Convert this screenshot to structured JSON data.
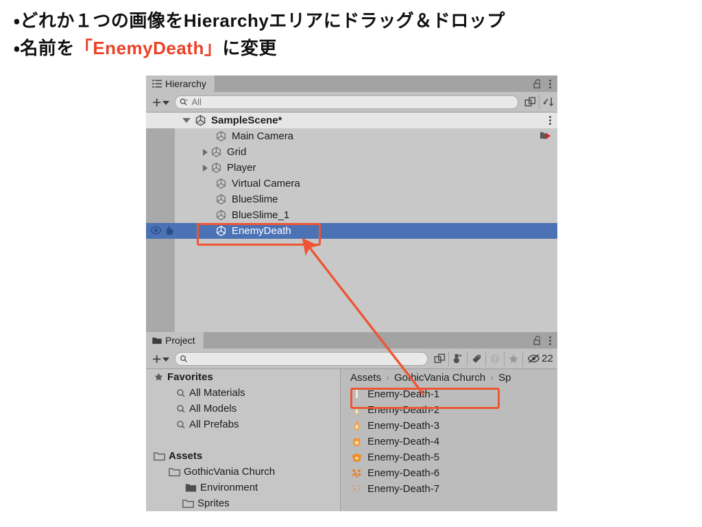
{
  "instructions": {
    "line1": "・どれか１つの画像をHierarchyエリアにドラッグ＆ドロップ",
    "line2_pre": "・名前を",
    "line2_highlight": "「EnemyDeath」",
    "line2_post": "に変更",
    "highlight_color": "#ec4126"
  },
  "hierarchy": {
    "tab_label": "Hierarchy",
    "tab_icon": "hierarchy-list-icon",
    "lock_icon": "lock-open-icon",
    "menu_icon": "kebab-menu-icon",
    "toolbar": {
      "add_label": "+",
      "add_dropdown_icon": "chevron-down-icon",
      "search_value": "",
      "search_placeholder": "All",
      "search_icon": "search-dropdown-icon",
      "expand_icon": "open-in-new-icon",
      "sort_icon": "sort-descending-icon"
    },
    "scene": {
      "name": "SampleScene*",
      "expanded": true,
      "icon": "unity-scene-icon",
      "menu_icon": "kebab-menu-icon"
    },
    "items": [
      {
        "name": "Main Camera",
        "expandable": false,
        "selected": false,
        "badge_icon": "cinemachine-brain-icon"
      },
      {
        "name": "Grid",
        "expandable": true,
        "selected": false
      },
      {
        "name": "Player",
        "expandable": true,
        "selected": false
      },
      {
        "name": "Virtual Camera",
        "expandable": false,
        "selected": false
      },
      {
        "name": "BlueSlime",
        "expandable": false,
        "selected": false
      },
      {
        "name": "BlueSlime_1",
        "expandable": false,
        "selected": false
      },
      {
        "name": "EnemyDeath",
        "expandable": false,
        "selected": true,
        "vis_icons": [
          "eye-icon",
          "hand-icon"
        ]
      }
    ],
    "selection_color": "#4a72b5"
  },
  "project": {
    "tab_label": "Project",
    "tab_icon": "folder-icon",
    "lock_icon": "lock-open-icon",
    "menu_icon": "kebab-menu-icon",
    "toolbar": {
      "add_label": "+",
      "add_dropdown_icon": "chevron-down-icon",
      "search_value": "",
      "search_placeholder": "",
      "search_icon": "search-icon",
      "expand_icon": "open-in-new-icon",
      "type_filter_icon": "asset-type-filter-icon",
      "label_filter_icon": "label-tag-icon",
      "warning_filter_icon": "warning-circle-icon",
      "favorite_filter_icon": "star-icon",
      "hidden_packages_icon": "eye-off-icon",
      "hidden_packages_count": "22"
    },
    "tree": [
      {
        "label": "Favorites",
        "indent": 0,
        "twisty": "down",
        "icon": "star-icon",
        "bold": true
      },
      {
        "label": "All Materials",
        "indent": 1,
        "twisty": "none",
        "icon": "search-icon",
        "bold": false
      },
      {
        "label": "All Models",
        "indent": 1,
        "twisty": "none",
        "icon": "search-icon",
        "bold": false
      },
      {
        "label": "All Prefabs",
        "indent": 1,
        "twisty": "none",
        "icon": "search-icon",
        "bold": false
      },
      {
        "label": "",
        "indent": 0,
        "twisty": "none",
        "icon": "none",
        "bold": false
      },
      {
        "label": "Assets",
        "indent": 0,
        "twisty": "down",
        "icon": "folder-open-icon",
        "bold": true
      },
      {
        "label": "GothicVania Church",
        "indent": 1,
        "twisty": "down",
        "icon": "folder-open-icon",
        "bold": false
      },
      {
        "label": "Environment",
        "indent": 2,
        "twisty": "none",
        "icon": "folder-icon",
        "bold": false
      },
      {
        "label": "Sprites",
        "indent": 2,
        "twisty": "down",
        "icon": "folder-open-icon",
        "bold": false
      }
    ],
    "breadcrumb": [
      "Assets",
      "GothicVania Church",
      "Sp"
    ],
    "breadcrumb_separator": "›",
    "assets": [
      {
        "name": "Enemy-Death-1",
        "expandable": true,
        "thumb": "sprite-death-1",
        "highlighted": true
      },
      {
        "name": "Enemy-Death-2",
        "expandable": true,
        "thumb": "sprite-death-2",
        "highlighted": false
      },
      {
        "name": "Enemy-Death-3",
        "expandable": true,
        "thumb": "sprite-death-3",
        "highlighted": false
      },
      {
        "name": "Enemy-Death-4",
        "expandable": true,
        "thumb": "sprite-death-4",
        "highlighted": false
      },
      {
        "name": "Enemy-Death-5",
        "expandable": true,
        "thumb": "sprite-death-5",
        "highlighted": false
      },
      {
        "name": "Enemy-Death-6",
        "expandable": true,
        "thumb": "sprite-death-6",
        "highlighted": false
      },
      {
        "name": "Enemy-Death-7",
        "expandable": true,
        "thumb": "sprite-death-7",
        "highlighted": false
      }
    ]
  },
  "annotation": {
    "color": "#ee5533",
    "arrow_from": "Enemy-Death-1 asset row",
    "arrow_to": "EnemyDeath hierarchy row"
  }
}
